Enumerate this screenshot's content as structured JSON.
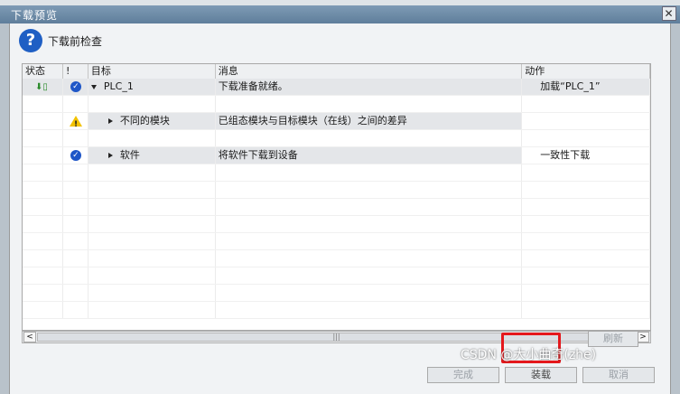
{
  "window": {
    "title": "下载预览",
    "close_label": "✕"
  },
  "header": {
    "label": "下载前检查"
  },
  "table": {
    "columns": [
      "状态",
      "!",
      "目标",
      "消息",
      "动作"
    ],
    "rows": [
      {
        "target": "PLC_1",
        "message": "下载准备就绪。",
        "action": "加载“PLC_1”"
      },
      {
        "target": "",
        "message": "",
        "action": ""
      },
      {
        "target": "不同的模块",
        "message": "已组态模块与目标模块（在线）之间的差异",
        "action": ""
      },
      {
        "target": "",
        "message": "",
        "action": ""
      },
      {
        "target": "软件",
        "message": "将软件下载到设备",
        "action": "一致性下载"
      }
    ]
  },
  "buttons": {
    "refresh": "刷新",
    "finish": "完成",
    "load": "装载",
    "cancel": "取消"
  },
  "watermark": "CSDN @大小曲奇(zhe)",
  "colors": {
    "title_bar": "#6f8ea9",
    "highlight": "#e5181c",
    "check": "#1e56c7",
    "warning": "#f2c200"
  }
}
